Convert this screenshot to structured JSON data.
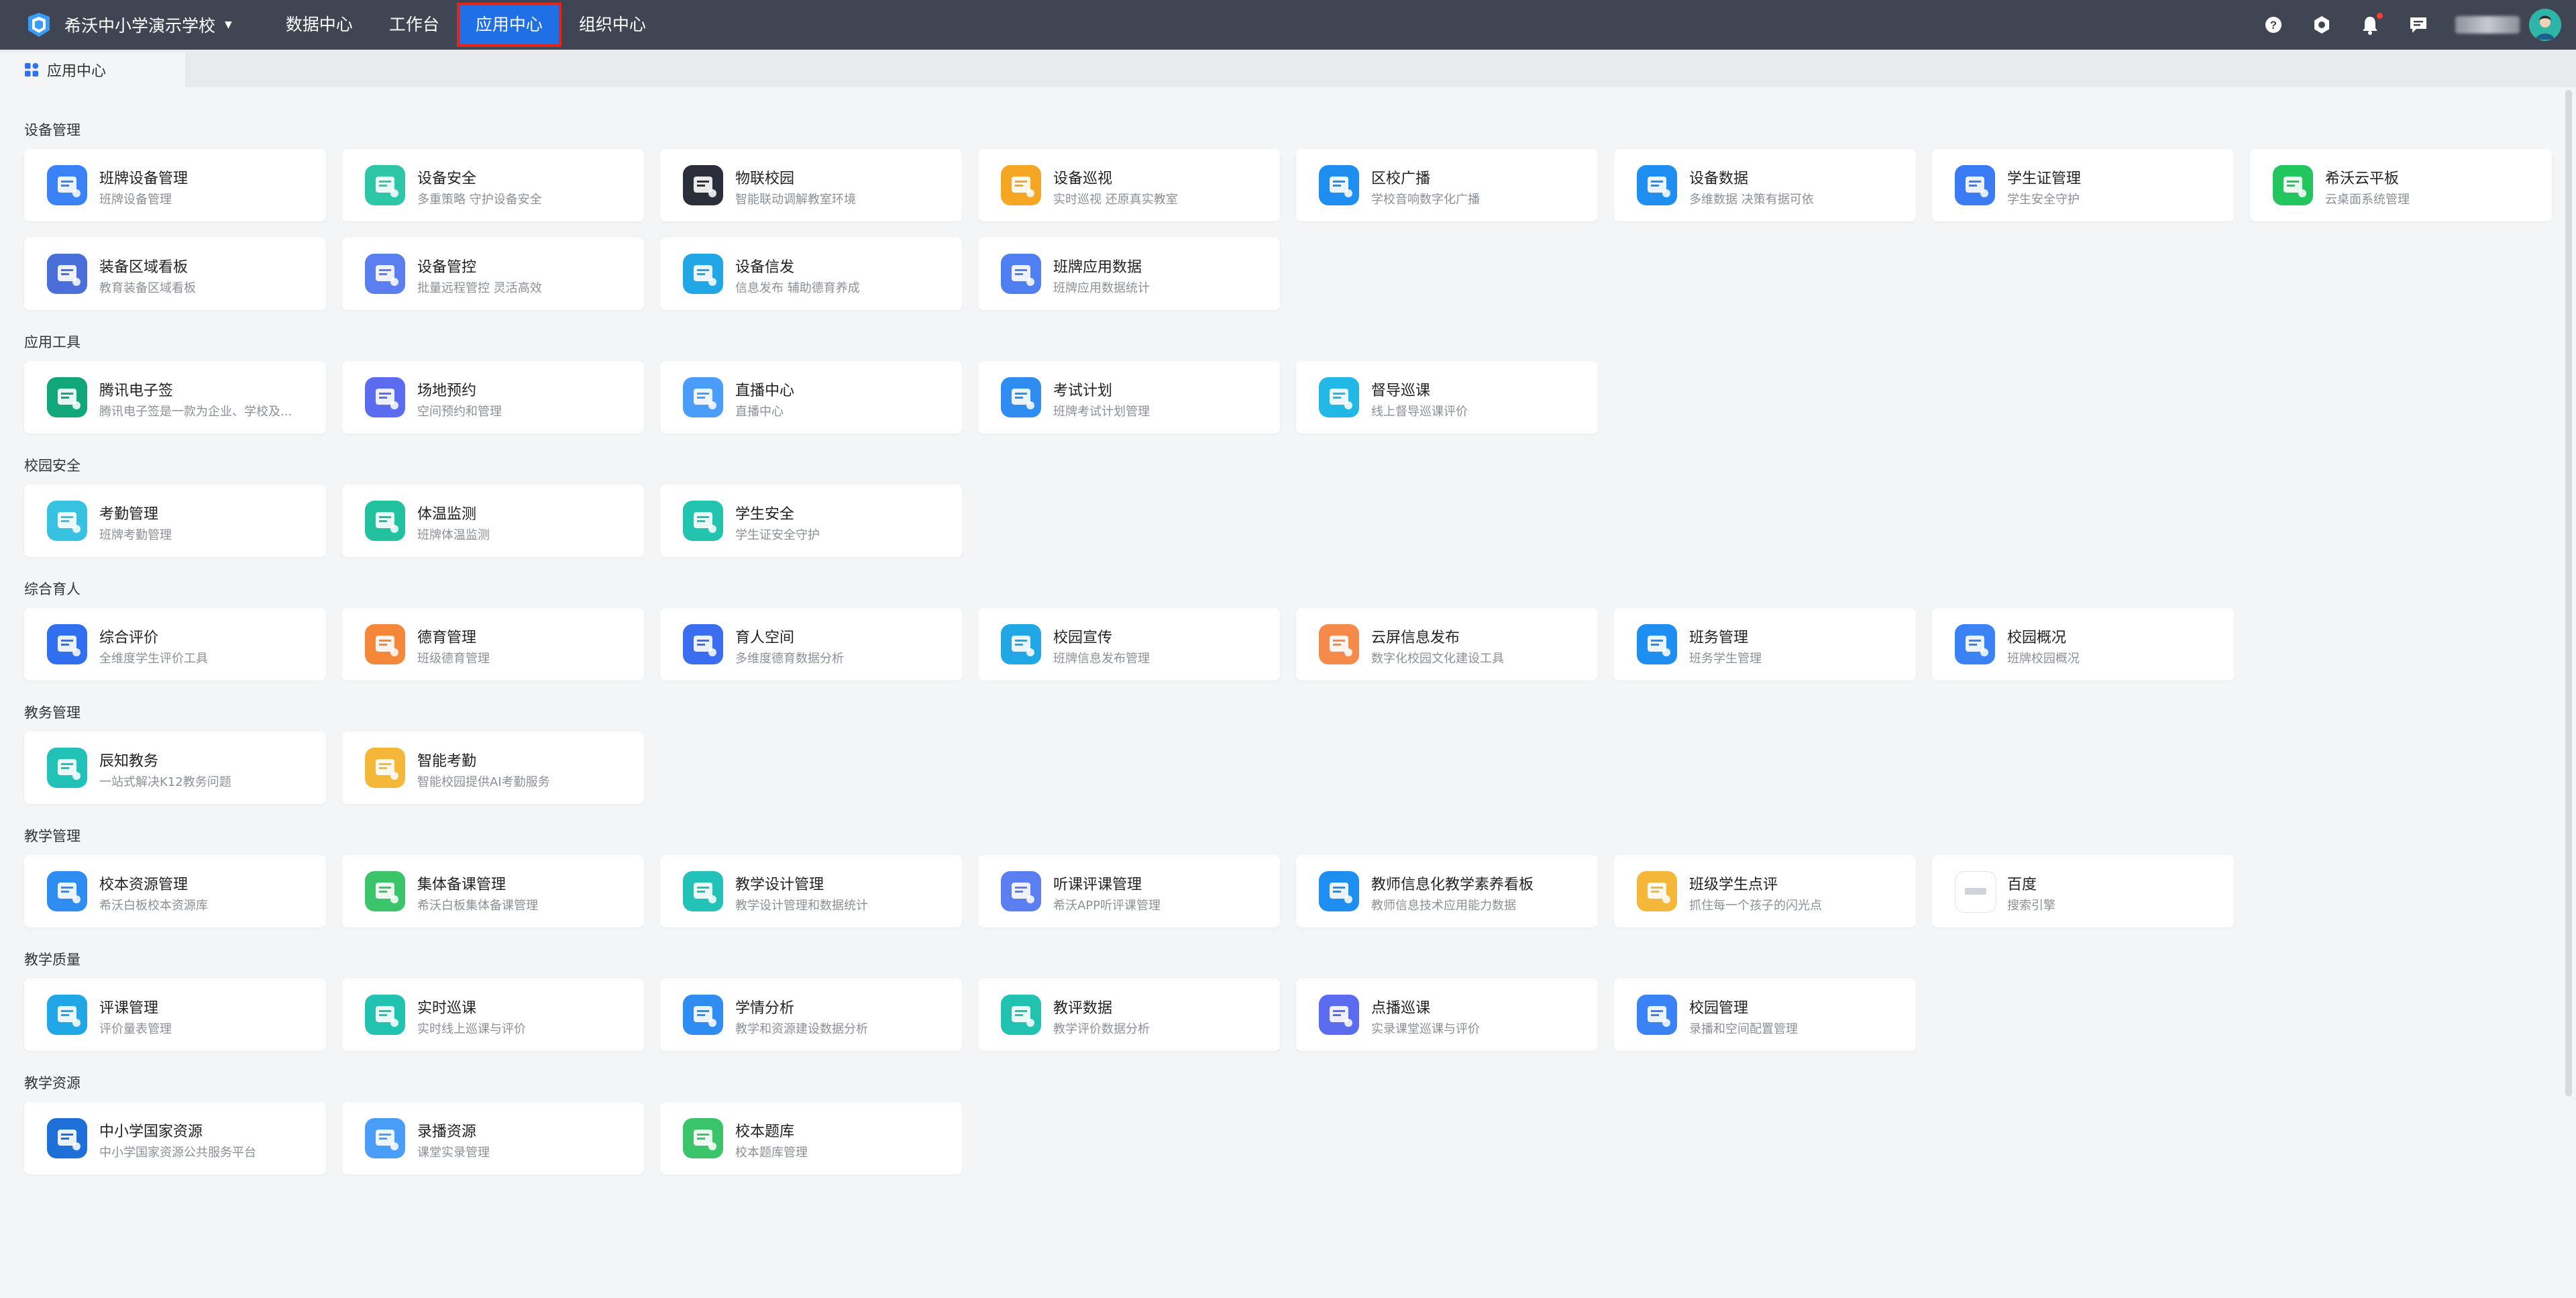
{
  "header": {
    "school_name": "希沃中小学演示学校",
    "nav": [
      {
        "label": "数据中心",
        "active": false
      },
      {
        "label": "工作台",
        "active": false
      },
      {
        "label": "应用中心",
        "active": true
      },
      {
        "label": "组织中心",
        "active": false
      }
    ],
    "icons": [
      "help-icon",
      "settings-icon",
      "bell-icon",
      "message-icon"
    ]
  },
  "tab": {
    "label": "应用中心"
  },
  "sections": [
    {
      "title": "设备管理",
      "apps": [
        {
          "name": "班牌设备管理",
          "desc": "班牌设备管理",
          "color": "#3b82f6"
        },
        {
          "name": "设备安全",
          "desc": "多重策略 守护设备安全",
          "color": "#2dc7a8"
        },
        {
          "name": "物联校园",
          "desc": "智能联动调解教室环境",
          "color": "#2a2f3a"
        },
        {
          "name": "设备巡视",
          "desc": "实时巡视 还原真实教室",
          "color": "#f5a623"
        },
        {
          "name": "区校广播",
          "desc": "学校音响数字化广播",
          "color": "#1e8ff0"
        },
        {
          "name": "设备数据",
          "desc": "多维数据 决策有据可依",
          "color": "#1e8ff0"
        },
        {
          "name": "学生证管理",
          "desc": "学生安全守护",
          "color": "#3b7cf5"
        },
        {
          "name": "希沃云平板",
          "desc": "云桌面系统管理",
          "color": "#22c55e"
        },
        {
          "name": "装备区域看板",
          "desc": "教育装备区域看板",
          "color": "#4a6fd8"
        },
        {
          "name": "设备管控",
          "desc": "批量远程管控 灵活高效",
          "color": "#5b7ef0"
        },
        {
          "name": "设备信发",
          "desc": "信息发布 辅助德育养成",
          "color": "#22a7e6"
        },
        {
          "name": "班牌应用数据",
          "desc": "班牌应用数据统计",
          "color": "#4f7ff0"
        }
      ]
    },
    {
      "title": "应用工具",
      "apps": [
        {
          "name": "腾讯电子签",
          "desc": "腾讯电子签是一款为企业、学校及...",
          "color": "#12a77a"
        },
        {
          "name": "场地预约",
          "desc": "空间预约和管理",
          "color": "#5b6cf0"
        },
        {
          "name": "直播中心",
          "desc": "直播中心",
          "color": "#4a9df8"
        },
        {
          "name": "考试计划",
          "desc": "班牌考试计划管理",
          "color": "#2f8cf0"
        },
        {
          "name": "督导巡课",
          "desc": "线上督导巡课评价",
          "color": "#22b8e6"
        }
      ]
    },
    {
      "title": "校园安全",
      "apps": [
        {
          "name": "考勤管理",
          "desc": "班牌考勤管理",
          "color": "#36c2e0"
        },
        {
          "name": "体温监测",
          "desc": "班牌体温监测",
          "color": "#22c2a0"
        },
        {
          "name": "学生安全",
          "desc": "学生证安全守护",
          "color": "#22c4b0"
        }
      ]
    },
    {
      "title": "综合育人",
      "apps": [
        {
          "name": "综合评价",
          "desc": "全维度学生评价工具",
          "color": "#2f6ff0"
        },
        {
          "name": "德育管理",
          "desc": "班级德育管理",
          "color": "#f5873a"
        },
        {
          "name": "育人空间",
          "desc": "多维度德育数据分析",
          "color": "#3b6df0"
        },
        {
          "name": "校园宣传",
          "desc": "班牌信息发布管理",
          "color": "#22a7e6"
        },
        {
          "name": "云屏信息发布",
          "desc": "数字化校园文化建设工具",
          "color": "#f58a4a"
        },
        {
          "name": "班务管理",
          "desc": "班务学生管理",
          "color": "#1e8ff0"
        },
        {
          "name": "校园概况",
          "desc": "班牌校园概况",
          "color": "#3b82f6"
        }
      ]
    },
    {
      "title": "教务管理",
      "apps": [
        {
          "name": "辰知教务",
          "desc": "一站式解决K12教务问题",
          "color": "#22c2b8"
        },
        {
          "name": "智能考勤",
          "desc": "智能校园提供AI考勤服务",
          "color": "#f5b73a"
        }
      ]
    },
    {
      "title": "教学管理",
      "apps": [
        {
          "name": "校本资源管理",
          "desc": "希沃白板校本资源库",
          "color": "#2f8cf0"
        },
        {
          "name": "集体备课管理",
          "desc": "希沃白板集体备课管理",
          "color": "#3cc46a"
        },
        {
          "name": "教学设计管理",
          "desc": "教学设计管理和数据统计",
          "color": "#22c2b8"
        },
        {
          "name": "听课评课管理",
          "desc": "希沃APP听评课管理",
          "color": "#5b7ef0"
        },
        {
          "name": "教师信息化教学素养看板",
          "desc": "教师信息技术应用能力数据",
          "color": "#1e8ff0"
        },
        {
          "name": "班级学生点评",
          "desc": "抓住每一个孩子的闪光点",
          "color": "#f5b73a"
        },
        {
          "name": "百度",
          "desc": "搜索引擎",
          "color": "#ffffff"
        }
      ]
    },
    {
      "title": "教学质量",
      "apps": [
        {
          "name": "评课管理",
          "desc": "评价量表管理",
          "color": "#22a7e6"
        },
        {
          "name": "实时巡课",
          "desc": "实时线上巡课与评价",
          "color": "#22c2b0"
        },
        {
          "name": "学情分析",
          "desc": "教学和资源建设数据分析",
          "color": "#2f8cf0"
        },
        {
          "name": "教评数据",
          "desc": "教学评价数据分析",
          "color": "#22c2b0"
        },
        {
          "name": "点播巡课",
          "desc": "实录课堂巡课与评价",
          "color": "#5b6cf0"
        },
        {
          "name": "校园管理",
          "desc": "录播和空间配置管理",
          "color": "#3b82f6"
        }
      ]
    },
    {
      "title": "教学资源",
      "apps": [
        {
          "name": "中小学国家资源",
          "desc": "中小学国家资源公共服务平台",
          "color": "#1e6fd8"
        },
        {
          "name": "录播资源",
          "desc": "课堂实录管理",
          "color": "#4a9df8"
        },
        {
          "name": "校本题库",
          "desc": "校本题库管理",
          "color": "#3cc46a"
        }
      ]
    }
  ]
}
